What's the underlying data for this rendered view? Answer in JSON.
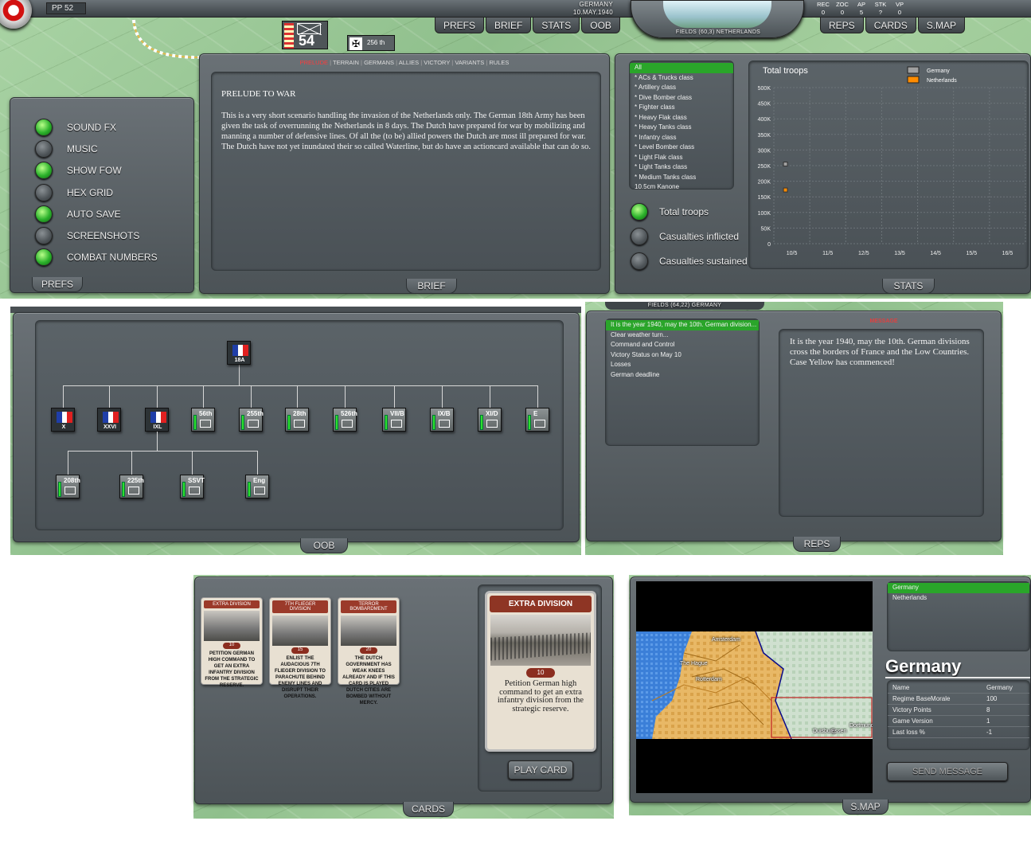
{
  "topbar": {
    "pp": "PP",
    "pp_value": "52",
    "country": "GERMANY",
    "date": "10.MAY.1940",
    "menu_left": [
      "PREFS",
      "BRIEF",
      "STATS",
      "OOB"
    ],
    "menu_right": [
      "REPS",
      "CARDS",
      "S.MAP"
    ],
    "location": "FIELDS (60,3) NETHERLANDS",
    "stats_labels": [
      "REC",
      "ZOC",
      "AP",
      "STK",
      "VP"
    ],
    "stats_values": [
      "0",
      "0",
      "5",
      "?",
      "0"
    ],
    "unit_strength": "54",
    "unit2_label": "256 th"
  },
  "prefs": {
    "tab": "PREFS",
    "items": [
      {
        "label": "SOUND FX",
        "on": true
      },
      {
        "label": "MUSIC",
        "on": false
      },
      {
        "label": "SHOW FOW",
        "on": true
      },
      {
        "label": "HEX GRID",
        "on": false
      },
      {
        "label": "AUTO SAVE",
        "on": true
      },
      {
        "label": "SCREENSHOTS",
        "on": false
      },
      {
        "label": "COMBAT NUMBERS",
        "on": true
      }
    ]
  },
  "brief": {
    "tab": "BRIEF",
    "nav": [
      "PRELUDE",
      "TERRAIN",
      "GERMANS",
      "ALLIES",
      "VICTORY",
      "VARIANTS",
      "RULES"
    ],
    "title": "PRELUDE TO WAR",
    "text": "This is a very short scenario handling the invasion of the Netherlands only. The German 18th Army has been given the task of overrunning the Netherlands in 8 days. The Dutch have prepared for war by mobilizing and manning a number of defensive lines. Of all the (to be) allied powers the Dutch are most ill prepared for war. The Dutch have not yet inundated their so called Waterline, but do have an actioncard available that can do so."
  },
  "stats": {
    "tab": "STATS",
    "classes": [
      "All",
      "* ACs & Trucks class",
      "* Artillery class",
      "* Dive Bomber class",
      "* Fighter class",
      "* Heavy Flak class",
      "* Heavy Tanks class",
      "* Infantry class",
      "* Level Bomber class",
      "* Light Flak class",
      "* Light Tanks class",
      "* Medium Tanks class",
      "10.5cm Kanone"
    ],
    "options": [
      {
        "label": "Total troops",
        "on": true
      },
      {
        "label": "Casualties inflicted",
        "on": false
      },
      {
        "label": "Casualties sustained",
        "on": false
      }
    ]
  },
  "chart_data": {
    "type": "scatter",
    "title": "Total troops",
    "xlabel": "",
    "ylabel": "",
    "categories": [
      "10/5",
      "11/5",
      "12/5",
      "13/5",
      "14/5",
      "15/5",
      "16/5"
    ],
    "yticks": [
      "500K",
      "450K",
      "400K",
      "350K",
      "300K",
      "250K",
      "200K",
      "150K",
      "100K",
      "50K",
      "0"
    ],
    "ylim": [
      0,
      500000
    ],
    "series": [
      {
        "name": "Germany",
        "color": "#a0a0a0",
        "points": [
          {
            "x": "10/5",
            "y": 255000
          }
        ]
      },
      {
        "name": "Netherlands",
        "color": "#ff8c00",
        "points": [
          {
            "x": "10/5",
            "y": 172000
          }
        ]
      }
    ],
    "legend": "top-right",
    "grid": true
  },
  "oob": {
    "tab": "OOB",
    "root": "18A",
    "corps": [
      {
        "label": "X",
        "type": "fr"
      },
      {
        "label": "XXVI",
        "type": "fr"
      },
      {
        "label": "IXL",
        "type": "fr"
      },
      {
        "label": "56th",
        "type": "unit"
      },
      {
        "label": "255th",
        "type": "unit"
      },
      {
        "label": "28th",
        "type": "unit"
      },
      {
        "label": "526th",
        "type": "unit"
      },
      {
        "label": "VII/B",
        "type": "unit"
      },
      {
        "label": "IX/B",
        "type": "unit"
      },
      {
        "label": "XI/D",
        "type": "unit"
      },
      {
        "label": "E",
        "type": "unit"
      }
    ],
    "sub": [
      {
        "label": "208th",
        "type": "unit"
      },
      {
        "label": "225th",
        "type": "unit"
      },
      {
        "label": "SSVT",
        "type": "unit"
      },
      {
        "label": "Eng",
        "type": "unit"
      }
    ]
  },
  "reps": {
    "tab": "REPS",
    "header": "FIELDS (64,22) GERMANY",
    "message_label": "MESSAGE",
    "items": [
      "It is the year 1940, may the 10th. German division...",
      "Clear weather turn...",
      "Command and Control",
      "Victory Status on May 10",
      "Losses",
      "German deadline"
    ],
    "message": "It is the year 1940, may the 10th. German divisions cross the borders of France and the Low Countries. Case Yellow has commenced!"
  },
  "cards": {
    "tab": "CARDS",
    "hand": [
      {
        "title": "EXTRA DIVISION",
        "num": "10",
        "text": "PETITION GERMAN HIGH COMMAND TO GET AN EXTRA INFANTRY DIVISION FROM THE STRATEGIC RESERVE."
      },
      {
        "title": "7TH FLIEGER DIVISION",
        "num": "15",
        "text": "ENLIST THE AUDACIOUS 7TH FLIEGER DIVISION TO PARACHUTE BEHIND ENEMY LINES AND DISRUPT THEIR OPERATIONS."
      },
      {
        "title": "TERROR BOMBARDMENT",
        "num": "20",
        "text": "THE DUTCH GOVERNMENT HAS WEAK KNEES ALREADY AND IF THIS CARD IS PLAYED DUTCH CITIES ARE BOMBED WITHOUT MERCY."
      }
    ],
    "selected": {
      "title": "EXTRA DIVISION",
      "num": "10",
      "text": "Petition German high command to get an extra infantry division from the strategic reserve."
    },
    "play_label": "PLAY CARD"
  },
  "smap": {
    "tab": "S.MAP",
    "countries": [
      "Germany",
      "Netherlands"
    ],
    "heading": "Germany",
    "cities": [
      "Amsterdam",
      "The Hague",
      "Rotterdam",
      "Duisburg",
      "Essen",
      "Dortmund"
    ],
    "table": [
      [
        "Name",
        "Germany"
      ],
      [
        "Regime BaseMorale",
        "100"
      ],
      [
        "Victory Points",
        "8"
      ],
      [
        "Game Version",
        "1"
      ],
      [
        "Last loss %",
        "-1"
      ]
    ],
    "send_label": "SEND MESSAGE"
  }
}
